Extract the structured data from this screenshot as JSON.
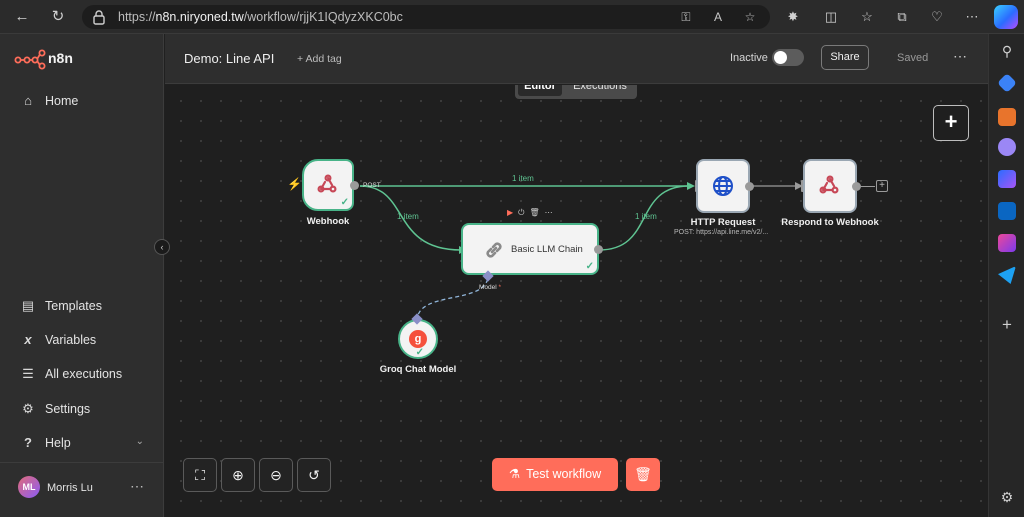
{
  "browser": {
    "url_prefix": "https://",
    "url_host": "n8n.niryoned.tw",
    "url_path": "/workflow/rjjK1IQdyzXKC0bc"
  },
  "app": {
    "name": "n8n",
    "accent": "#ff6d5a",
    "success": "#48b388"
  },
  "sidebar": {
    "home": "Home",
    "templates": "Templates",
    "variables": "Variables",
    "all_executions": "All executions",
    "settings": "Settings",
    "help": "Help",
    "user": {
      "initials": "ML",
      "name": "Morris Lu"
    }
  },
  "header": {
    "title": "Demo: Line API",
    "add_tag": "+ Add tag",
    "active_label": "Inactive",
    "active": false,
    "share": "Share",
    "saved": "Saved"
  },
  "tabs": {
    "editor": "Editor",
    "executions": "Executions",
    "selected": "Editor"
  },
  "nodes": {
    "webhook": {
      "label": "Webhook",
      "output": "POST",
      "icon": "webhook-icon"
    },
    "llm_chain": {
      "label": "Basic LLM Chain",
      "icon": "link-icon",
      "input_label": "Model",
      "required_marker": "*"
    },
    "groq": {
      "label": "Groq Chat Model",
      "icon": "groq-icon"
    },
    "http": {
      "label": "HTTP Request",
      "subtitle": "POST: https://api.line.me/v2/...",
      "icon": "globe-icon"
    },
    "respond": {
      "label": "Respond to Webhook",
      "icon": "webhook-icon"
    }
  },
  "edges": {
    "webhook_http": "1 item",
    "webhook_llm": "1 item",
    "llm_http": "1 item"
  },
  "actions": {
    "test_workflow": "Test workflow"
  }
}
